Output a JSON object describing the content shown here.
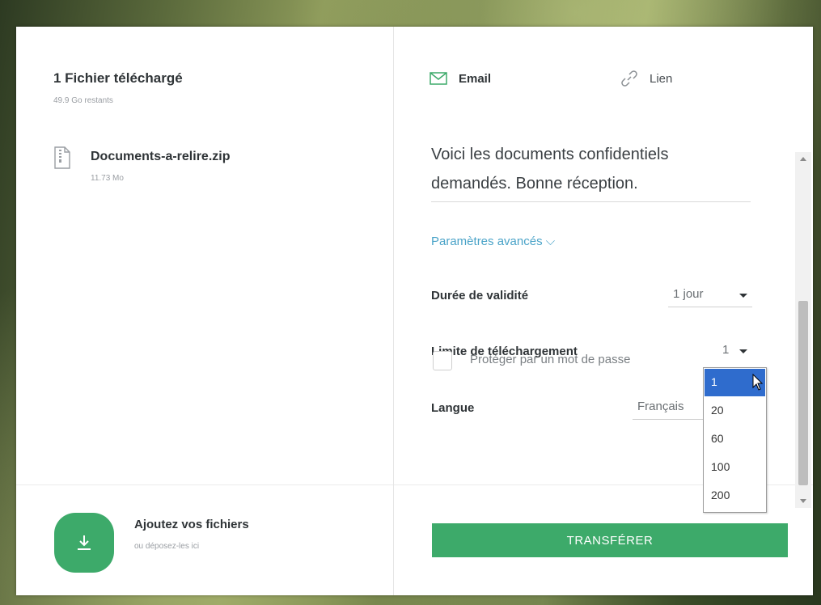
{
  "upload": {
    "title": "1 Fichier téléchargé",
    "remaining": "49.9 Go restants"
  },
  "files": [
    {
      "name": "Documents-a-relire.zip",
      "size": "11.73 Mo",
      "icon": "zip-file-icon"
    }
  ],
  "dropzone": {
    "title": "Ajoutez vos fichiers",
    "subtitle": "ou déposez-les ici",
    "icon": "download-icon"
  },
  "tabs": {
    "email": {
      "label": "Email",
      "icon": "envelope-icon"
    },
    "link": {
      "label": "Lien",
      "icon": "link-icon"
    }
  },
  "form": {
    "message": "Voici les documents confidentiels demandés. Bonne réception.",
    "advanced_label": "Paramètres avancés ⌵",
    "validity": {
      "label": "Durée de validité",
      "value": "1 jour"
    },
    "download_limit": {
      "label": "Limite de téléchargement",
      "value": "1",
      "options": [
        "1",
        "20",
        "60",
        "100",
        "200"
      ],
      "highlighted": "1"
    },
    "language": {
      "label": "Langue",
      "value": "Français"
    },
    "password": {
      "label": "Protéger par un mot de passe",
      "checked": false
    }
  },
  "transfer_button": "TRANSFÉRER",
  "colors": {
    "accent": "#3daa6a",
    "link": "#4aa3c8",
    "selected_option": "#2f6ccd"
  }
}
